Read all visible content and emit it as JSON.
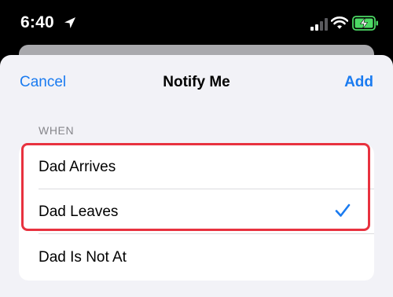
{
  "status_bar": {
    "time": "6:40"
  },
  "nav": {
    "cancel_label": "Cancel",
    "title": "Notify Me",
    "add_label": "Add"
  },
  "section": {
    "header": "WHEN"
  },
  "options": [
    {
      "label": "Dad Arrives",
      "selected": false
    },
    {
      "label": "Dad Leaves",
      "selected": true
    },
    {
      "label": "Dad Is Not At",
      "selected": false
    }
  ],
  "colors": {
    "accent": "#1a7bf0",
    "highlight": "#e8323f",
    "battery_charging": "#4cd964"
  },
  "icons": [
    "location-arrow-icon",
    "cellular-signal-icon",
    "wifi-icon",
    "battery-charging-icon",
    "checkmark-icon"
  ]
}
